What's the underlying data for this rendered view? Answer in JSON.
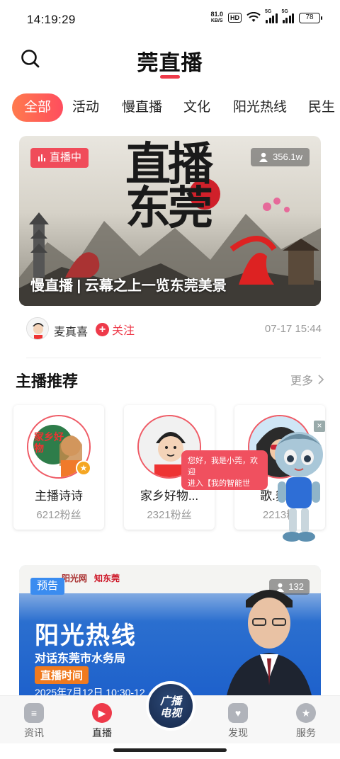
{
  "status_bar": {
    "time": "14:19:29",
    "net_speed": "81.0",
    "net_unit": "KB/S",
    "hd": "HD",
    "sim1": "5G",
    "sim2": "5G",
    "battery": "78"
  },
  "header": {
    "title": "莞直播",
    "accent_color": "#ee3a4a"
  },
  "tabs": [
    {
      "label": "全部",
      "active": true
    },
    {
      "label": "活动"
    },
    {
      "label": "慢直播"
    },
    {
      "label": "文化"
    },
    {
      "label": "阳光热线"
    },
    {
      "label": "民生"
    }
  ],
  "hero": {
    "badge": "直播中",
    "viewers": "356.1w",
    "title": "慢直播 | 云幕之上一览东莞美景",
    "calligraphy_text": "直播东莞",
    "author": "麦真喜",
    "follow_label": "关注",
    "time": "07-17 15:44"
  },
  "anchors_section": {
    "title": "主播推荐",
    "more_label": "更多",
    "items": [
      {
        "name": "主播诗诗",
        "fans": "6212粉丝",
        "avatar_text": "家乡好物"
      },
      {
        "name": "家乡好物...",
        "fans": "2321粉丝"
      },
      {
        "name": "歌.舞走",
        "fans": "2213粉"
      }
    ]
  },
  "assistant": {
    "bubble_line1": "您好，我是小莞，欢迎",
    "bubble_line2": "进入【我的智能世界】",
    "close": "×"
  },
  "promo": {
    "badge": "预告",
    "viewers": "132",
    "logo1": "阳光网",
    "logo2": "知东莞",
    "title": "阳光热线",
    "subtitle": "对话东莞市水务局",
    "time_label": "直播时间",
    "date": "2025年7月12日 10:30-12"
  },
  "bottom_nav": {
    "items": [
      {
        "label": "资讯",
        "icon": "news-icon"
      },
      {
        "label": "直播",
        "icon": "live-play-icon",
        "active": true
      },
      {
        "label": "发现",
        "icon": "discover-icon"
      },
      {
        "label": "服务",
        "icon": "service-icon"
      }
    ],
    "center_line1": "广播",
    "center_line2": "电视"
  }
}
